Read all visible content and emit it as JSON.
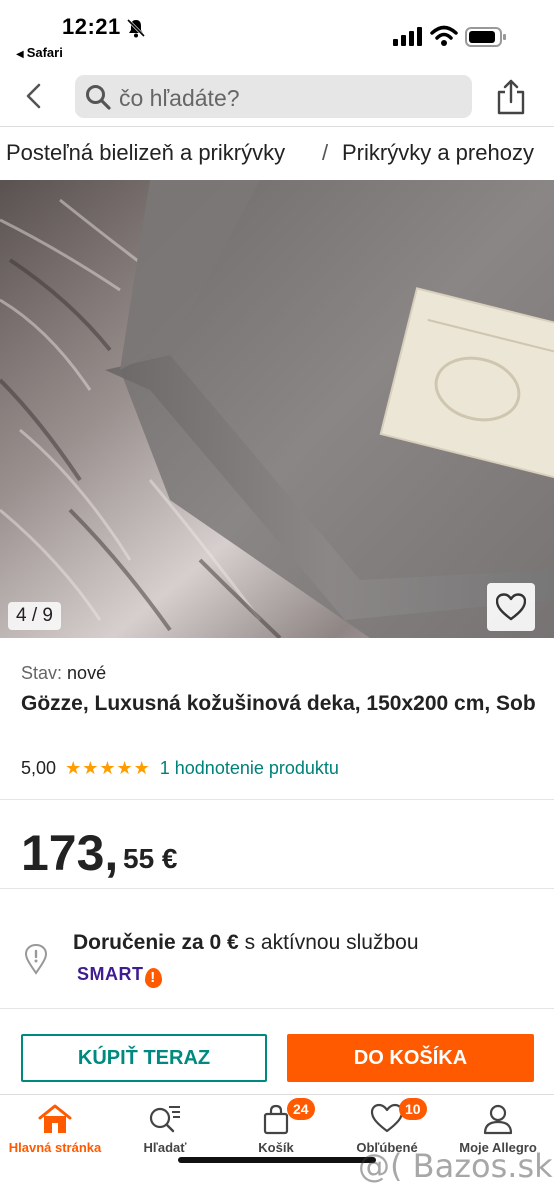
{
  "status": {
    "time": "12:21",
    "back_app": "Safari",
    "icons": [
      "bell-slash-icon",
      "signal-icon",
      "wifi-icon",
      "battery-icon"
    ]
  },
  "header": {
    "search_placeholder": "čo hľadáte?",
    "icons": [
      "chevron-left-icon",
      "search-icon",
      "share-icon"
    ]
  },
  "breadcrumb": {
    "items": [
      "Posteľná bielizeň a prikrývky",
      "Prikrývky a prehozy"
    ],
    "separator": "/"
  },
  "gallery": {
    "counter": "4 / 9",
    "current": 4,
    "total": 9
  },
  "product": {
    "condition_label": "Stav:",
    "condition_value": "nové",
    "title": "Gözze, Luxusná kožušinová deka, 150x200 cm, Sob",
    "rating_value": "5,00",
    "rating_stars": "★★★★★",
    "rating_link": "1 hodnotenie produktu"
  },
  "price": {
    "main": "173,",
    "cents": "55 €"
  },
  "delivery": {
    "bold_text": "Doručenie za 0 €",
    "rest_text": " s aktívnou službou",
    "smart_text": "SMART",
    "smart_mark": "!"
  },
  "actions": {
    "buy_now": "KÚPIŤ TERAZ",
    "add_to_cart": "DO KOŠÍKA"
  },
  "tabbar": {
    "tabs": [
      {
        "label": "Hlavná stránka",
        "icon": "home-icon",
        "active": true
      },
      {
        "label": "Hľadať",
        "icon": "search-list-icon"
      },
      {
        "label": "Košík",
        "icon": "bag-icon",
        "badge": "24"
      },
      {
        "label": "Obľúbené",
        "icon": "heart-icon",
        "badge": "10"
      },
      {
        "label": "Moje Allegro",
        "icon": "user-icon"
      }
    ]
  },
  "watermark": "@( Bazos.sk",
  "colors": {
    "accent_orange": "#ff5a00",
    "accent_teal": "#008a7f",
    "star": "#ff9d00",
    "smart_purple": "#3f1c91"
  }
}
